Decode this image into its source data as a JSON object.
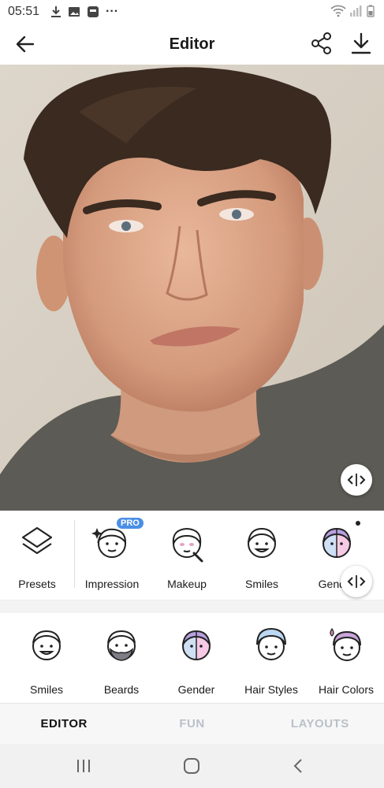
{
  "status_bar": {
    "time": "05:51",
    "more": "···"
  },
  "header": {
    "title": "Editor"
  },
  "tools_row1": [
    {
      "label": "Presets",
      "icon": "presets-icon"
    },
    {
      "label": "Impression",
      "icon": "impression-icon",
      "badge": "PRO"
    },
    {
      "label": "Makeup",
      "icon": "makeup-icon"
    },
    {
      "label": "Smiles",
      "icon": "smiles-icon"
    },
    {
      "label": "Gender",
      "icon": "gender-icon"
    }
  ],
  "tools_row2": [
    {
      "label": "Smiles",
      "icon": "smiles-icon"
    },
    {
      "label": "Beards",
      "icon": "beards-icon"
    },
    {
      "label": "Gender",
      "icon": "gender-icon"
    },
    {
      "label": "Hair Styles",
      "icon": "hair-styles-icon"
    },
    {
      "label": "Hair Colors",
      "icon": "hair-colors-icon"
    }
  ],
  "tabs": [
    {
      "label": "EDITOR",
      "active": true
    },
    {
      "label": "FUN",
      "active": false
    },
    {
      "label": "LAYOUTS",
      "active": false
    }
  ],
  "colors": {
    "accent": "#4a8fe7",
    "tab_inactive": "#b9c1c9"
  }
}
